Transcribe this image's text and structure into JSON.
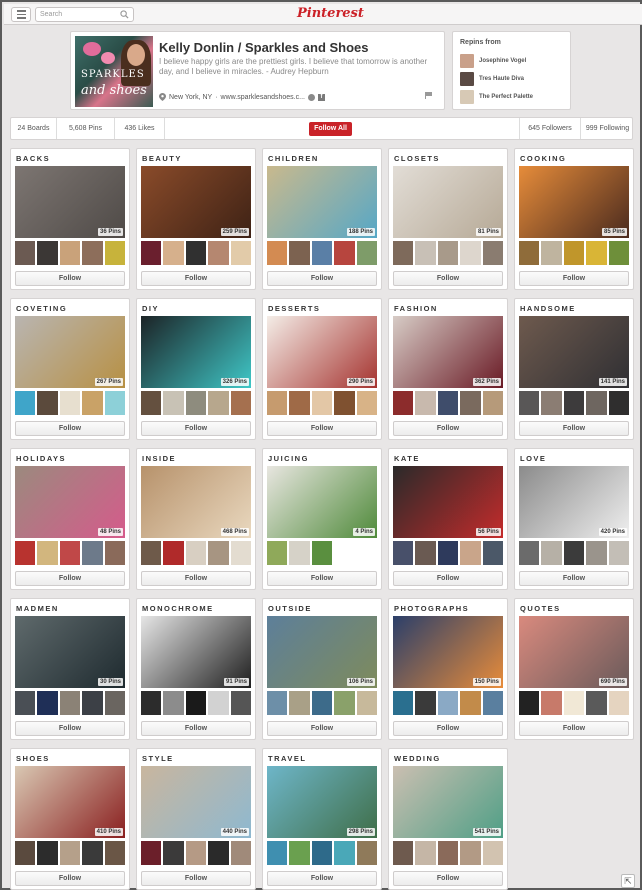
{
  "topbar": {
    "search_placeholder": "Search",
    "logo": "Pinterest"
  },
  "profile": {
    "name": "Kelly Donlin / Sparkles and Shoes",
    "bio": "I believe happy girls are the prettiest girls. I believe that tomorrow is another day, and I believe in miracles. - Audrey Hepburn",
    "location": "New York, NY",
    "website": "www.sparklesandshoes.c...",
    "avatar_text_1": "SPARKLES",
    "avatar_text_2": "and shoes"
  },
  "repins": {
    "title": "Repins from",
    "users": [
      "Josephine Vogel",
      "Tres Haute Diva",
      "The Perfect Palette"
    ]
  },
  "stats": {
    "boards": "24 Boards",
    "pins": "5,608 Pins",
    "likes": "436 Likes",
    "follow_all": "Follow All",
    "followers": "645 Followers",
    "following": "999 Following"
  },
  "follow_label": "Follow",
  "boards": [
    {
      "title": "BACKS",
      "pins": "36 Pins",
      "c": [
        "#7d7672",
        "#4f4a47"
      ],
      "t": [
        "#6b5a52",
        "#3b3735",
        "#c9a27a",
        "#8d6e5b",
        "#c7b33b"
      ]
    },
    {
      "title": "BEAUTY",
      "pins": "259 Pins",
      "c": [
        "#8a4b2a",
        "#3e2215"
      ],
      "t": [
        "#6a1f2e",
        "#d6b08c",
        "#303030",
        "#b58770",
        "#e2cba9"
      ]
    },
    {
      "title": "CHILDREN",
      "pins": "188 Pins",
      "c": [
        "#c9b98d",
        "#56a7c6"
      ],
      "t": [
        "#d38b52",
        "#7c6250",
        "#5a7fa6",
        "#b7453e",
        "#7e9c69"
      ]
    },
    {
      "title": "CLOSETS",
      "pins": "81 Pins",
      "c": [
        "#e2ddd6",
        "#b6a996"
      ],
      "t": [
        "#7e6a5b",
        "#c8c0b6",
        "#a89a8a",
        "#ddd6cd",
        "#8a7c70"
      ]
    },
    {
      "title": "COOKING",
      "pins": "85 Pins",
      "c": [
        "#e68c3a",
        "#4a2a1e"
      ],
      "t": [
        "#8f6c3a",
        "#bfb49f",
        "#c0962b",
        "#d9b536",
        "#6e8f3a"
      ]
    },
    {
      "title": "COVETING",
      "pins": "267 Pins",
      "c": [
        "#b9b5b1",
        "#b79043"
      ],
      "t": [
        "#3fa5c9",
        "#5b4a3c",
        "#e7dfcf",
        "#c9a267",
        "#8dd0d8"
      ]
    },
    {
      "title": "DIY",
      "pins": "326 Pins",
      "c": [
        "#1c2326",
        "#3fc7c7"
      ],
      "t": [
        "#64503f",
        "#c8c2b5",
        "#8e8c7e",
        "#b7a78d",
        "#a5704f"
      ]
    },
    {
      "title": "DESSERTS",
      "pins": "290 Pins",
      "c": [
        "#f4ede7",
        "#a5332f"
      ],
      "t": [
        "#c69b6e",
        "#9f6a47",
        "#e3c7a6",
        "#7f5130",
        "#d8b387"
      ]
    },
    {
      "title": "FASHION",
      "pins": "362 Pins",
      "c": [
        "#d7ccc6",
        "#6a1a25"
      ],
      "t": [
        "#8c2c2c",
        "#c8b9ad",
        "#3f4d6b",
        "#7a6a5e",
        "#b69a7a"
      ]
    },
    {
      "title": "HANDSOME",
      "pins": "141 Pins",
      "c": [
        "#6e5a4e",
        "#2f2f33"
      ],
      "t": [
        "#595757",
        "#8b7d73",
        "#3d3b3c",
        "#6e6660",
        "#2f2e2e"
      ]
    },
    {
      "title": "HOLIDAYS",
      "pins": "48 Pins",
      "c": [
        "#9b8a7e",
        "#d55b8b"
      ],
      "t": [
        "#b8332f",
        "#d2b67e",
        "#c04848",
        "#6d7a8a",
        "#8a6a5a"
      ]
    },
    {
      "title": "INSIDE",
      "pins": "468 Pins",
      "c": [
        "#b7926b",
        "#e9d8bf"
      ],
      "t": [
        "#6e5a4a",
        "#b02a2a",
        "#d8cfc2",
        "#a79582",
        "#e3dcd0"
      ]
    },
    {
      "title": "JUICING",
      "pins": "4 Pins",
      "c": [
        "#e8e6e0",
        "#4f8a3a"
      ],
      "t": [
        "#8fa95a",
        "#d6d2c8",
        "#5a8f3f",
        "#ffffff",
        "#ffffff"
      ]
    },
    {
      "title": "KATE",
      "pins": "56 Pins",
      "c": [
        "#2a2a2a",
        "#c42b2b"
      ],
      "t": [
        "#48506a",
        "#6a5a52",
        "#2e3a5c",
        "#c9a58a",
        "#4b5868"
      ]
    },
    {
      "title": "LOVE",
      "pins": "420 Pins",
      "c": [
        "#8b8b8b",
        "#efefef"
      ],
      "t": [
        "#6b6b6b",
        "#b6b0a6",
        "#3b3b3b",
        "#9a948c",
        "#c3beb6"
      ]
    },
    {
      "title": "MADMEN",
      "pins": "30 Pins",
      "c": [
        "#5f6a6c",
        "#1e2a2f"
      ],
      "t": [
        "#4a4f55",
        "#1f2f57",
        "#8b8276",
        "#3c4046",
        "#6a6560"
      ]
    },
    {
      "title": "MONOCHROME",
      "pins": "91 Pins",
      "c": [
        "#e6e6e6",
        "#1e1e1e"
      ],
      "t": [
        "#2c2c2c",
        "#8c8c8c",
        "#1a1a1a",
        "#d2d2d2",
        "#555555"
      ]
    },
    {
      "title": "OUTSIDE",
      "pins": "106 Pins",
      "c": [
        "#5d7f9a",
        "#7e8b5c"
      ],
      "t": [
        "#6d8fa8",
        "#a9a087",
        "#3d6b8a",
        "#8aa16a",
        "#c7b99b"
      ]
    },
    {
      "title": "PHOTOGRAPHS",
      "pins": "150 Pins",
      "c": [
        "#2b3f6a",
        "#e88c3a"
      ],
      "t": [
        "#2a6f8f",
        "#3a3a3a",
        "#8aa9c5",
        "#c28b4a",
        "#5a7f9f"
      ]
    },
    {
      "title": "QUOTES",
      "pins": "690 Pins",
      "c": [
        "#d98a7e",
        "#6a5a5a"
      ],
      "t": [
        "#222222",
        "#c77a6a",
        "#f1e8d6",
        "#5a5a5a",
        "#e5d4c0"
      ]
    },
    {
      "title": "SHOES",
      "pins": "410 Pins",
      "c": [
        "#d9c8b3",
        "#8a1f1f"
      ],
      "t": [
        "#5a4a3e",
        "#2c2c2c",
        "#b5a08a",
        "#3a3a3a",
        "#6a5646"
      ]
    },
    {
      "title": "STYLE",
      "pins": "440 Pins",
      "c": [
        "#c9b69e",
        "#8eb8d0"
      ],
      "t": [
        "#6b1f2a",
        "#3b3a3a",
        "#b59a85",
        "#2a2a2a",
        "#a08a7a"
      ]
    },
    {
      "title": "TRAVEL",
      "pins": "298 Pins",
      "c": [
        "#6eb6c9",
        "#3f6e48"
      ],
      "t": [
        "#3f8fb0",
        "#6aa04f",
        "#2e6a8a",
        "#4aa8b8",
        "#8f7a5a"
      ]
    },
    {
      "title": "WEDDING",
      "pins": "541 Pins",
      "c": [
        "#cbbfb1",
        "#4f9f86"
      ],
      "t": [
        "#6e5a4e",
        "#c5b6a6",
        "#8a6a5a",
        "#b29a85",
        "#d2c3b0"
      ]
    }
  ]
}
